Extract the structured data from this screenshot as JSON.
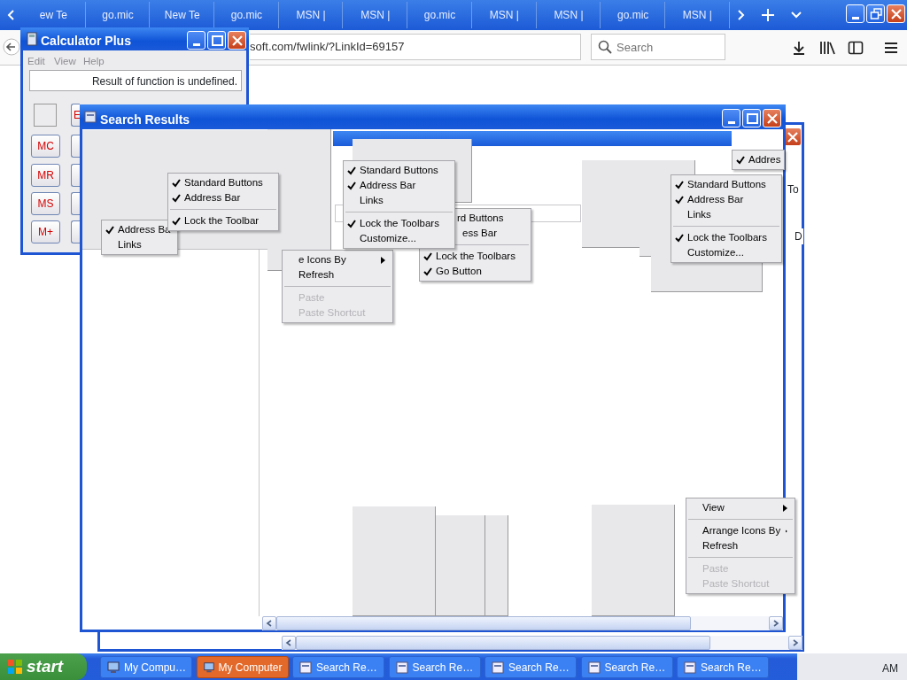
{
  "browser": {
    "tabs": [
      {
        "label": "ew Te",
        "selected": false
      },
      {
        "label": "go.mic",
        "selected": false
      },
      {
        "label": "New Te",
        "selected": false
      },
      {
        "label": "go.mic",
        "selected": false
      },
      {
        "label": "MSN |",
        "selected": false
      },
      {
        "label": "MSN |",
        "selected": false
      },
      {
        "label": "go.mic",
        "selected": false
      },
      {
        "label": "MSN |",
        "selected": false
      },
      {
        "label": "MSN |",
        "selected": false
      },
      {
        "label": "go.mic",
        "selected": false
      },
      {
        "label": "MSN |",
        "selected": false
      }
    ],
    "address": "soft.com/fwlink/?LinkId=69157",
    "search": {
      "placeholder": "Search"
    }
  },
  "calculator": {
    "title": "Calculator Plus",
    "menu": [
      {
        "label": "Edit",
        "disabled": true
      },
      {
        "label": "View",
        "disabled": true
      },
      {
        "label": "Help",
        "disabled": true
      }
    ],
    "display": "Result of function is undefined.",
    "buttons": [
      "E",
      "MC",
      "MR",
      "MS",
      "M+"
    ]
  },
  "search_results": {
    "title": "Search Results"
  },
  "back_window": {
    "texts": [
      "To",
      "D"
    ]
  },
  "menus": [
    {
      "items": [
        {
          "kind": "item",
          "label": "Address Ba",
          "checked": true,
          "disabled": false
        },
        {
          "kind": "item",
          "label": "Links",
          "checked": false,
          "disabled": false
        }
      ]
    },
    {
      "items": [
        {
          "kind": "item",
          "label": "Standard Buttons",
          "checked": true,
          "disabled": false
        },
        {
          "kind": "item",
          "label": "Address Bar",
          "checked": true,
          "disabled": false
        },
        {
          "kind": "separator"
        },
        {
          "kind": "item",
          "label": "Lock the Toolbar",
          "checked": true,
          "disabled": false
        }
      ]
    },
    {
      "items": [
        {
          "kind": "item",
          "label": "rd Buttons",
          "checked": false,
          "disabled": false
        },
        {
          "kind": "item",
          "label": "ess Bar",
          "checked": false,
          "disabled": false
        },
        {
          "kind": "separator"
        },
        {
          "kind": "item",
          "label": "Lock the Toolbars",
          "checked": true,
          "disabled": false
        },
        {
          "kind": "item",
          "label": "Go Button",
          "checked": true,
          "disabled": false
        }
      ]
    },
    {
      "items": [
        {
          "kind": "submenu",
          "label": "e Icons By",
          "checked": false,
          "disabled": false
        },
        {
          "kind": "item",
          "label": "Refresh",
          "checked": false,
          "disabled": false
        },
        {
          "kind": "separator"
        },
        {
          "kind": "item",
          "label": "Paste",
          "checked": false,
          "disabled": true
        },
        {
          "kind": "item",
          "label": "Paste Shortcut",
          "checked": false,
          "disabled": true
        }
      ]
    },
    {
      "items": [
        {
          "kind": "item",
          "label": "Standard Buttons",
          "checked": true,
          "disabled": false
        },
        {
          "kind": "item",
          "label": "Address Bar",
          "checked": true,
          "disabled": false
        },
        {
          "kind": "item",
          "label": "Links",
          "checked": false,
          "disabled": false
        },
        {
          "kind": "separator"
        },
        {
          "kind": "item",
          "label": "Lock the Toolbars",
          "checked": true,
          "disabled": false
        },
        {
          "kind": "item",
          "label": "Customize...",
          "checked": false,
          "disabled": false
        }
      ]
    },
    {
      "items": [
        {
          "kind": "item",
          "label": "Addres",
          "checked": true,
          "disabled": false
        }
      ]
    },
    {
      "items": [
        {
          "kind": "item",
          "label": "Standard Buttons",
          "checked": true,
          "disabled": false
        },
        {
          "kind": "item",
          "label": "Address Bar",
          "checked": true,
          "disabled": false
        },
        {
          "kind": "item",
          "label": "Links",
          "checked": false,
          "disabled": false
        },
        {
          "kind": "separator"
        },
        {
          "kind": "item",
          "label": "Lock the Toolbars",
          "checked": true,
          "disabled": false
        },
        {
          "kind": "item",
          "label": "Customize...",
          "checked": false,
          "disabled": false
        }
      ]
    },
    {
      "items": [
        {
          "kind": "submenu",
          "label": "View",
          "checked": false,
          "disabled": false
        },
        {
          "kind": "separator"
        },
        {
          "kind": "submenu",
          "label": "Arrange Icons By",
          "checked": false,
          "disabled": false
        },
        {
          "kind": "item",
          "label": "Refresh",
          "checked": false,
          "disabled": false
        },
        {
          "kind": "separator"
        },
        {
          "kind": "item",
          "label": "Paste",
          "checked": false,
          "disabled": true
        },
        {
          "kind": "item",
          "label": "Paste Shortcut",
          "checked": false,
          "disabled": true
        }
      ]
    }
  ],
  "taskbar": {
    "start": "start",
    "items": [
      {
        "kind": "computer",
        "label": "My Compu…",
        "selected": false
      },
      {
        "kind": "computer",
        "label": "My Computer",
        "selected": true
      },
      {
        "kind": "search",
        "label": "Search Re…",
        "selected": false
      },
      {
        "kind": "search",
        "label": "Search Re…",
        "selected": false
      },
      {
        "kind": "search",
        "label": "Search Re…",
        "selected": false
      },
      {
        "kind": "search",
        "label": "Search Re…",
        "selected": false
      },
      {
        "kind": "search",
        "label": "Search Re…",
        "selected": false
      }
    ],
    "clock": "AM"
  }
}
